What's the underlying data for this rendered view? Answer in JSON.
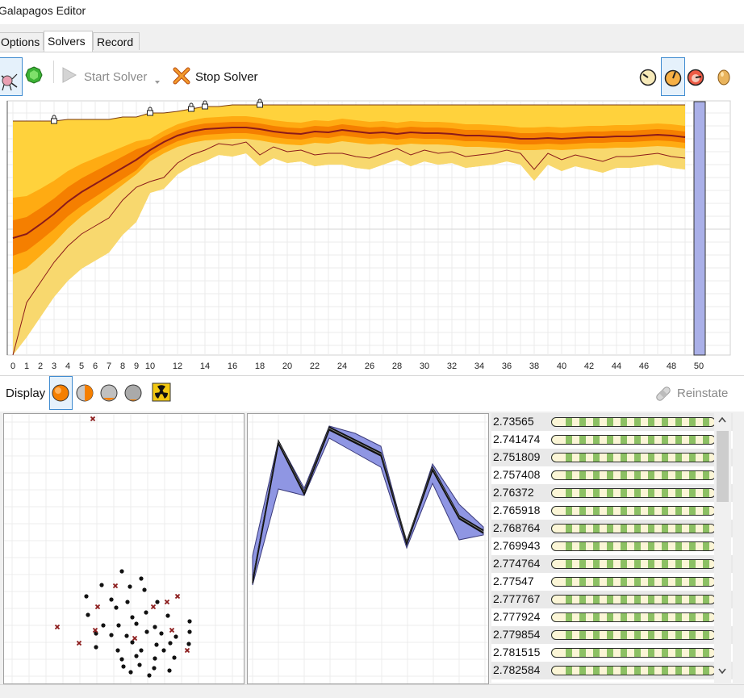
{
  "window": {
    "title": "Galapagos Editor"
  },
  "tabs": [
    {
      "label": "Options",
      "active": false
    },
    {
      "label": "Solvers",
      "active": true
    },
    {
      "label": "Record",
      "active": false
    }
  ],
  "toolbar": {
    "start_label": "Start Solver",
    "stop_label": "Stop Solver",
    "left_icons": [
      "evolutionary-solver-icon",
      "annealing-solver-icon"
    ],
    "right_icons": [
      "speed-slow-icon",
      "speed-medium-icon",
      "speed-fast-icon",
      "egg-icon"
    ]
  },
  "fitness_chart": {
    "x_ticks": [
      "0",
      "1",
      "2",
      "3",
      "4",
      "5",
      "6",
      "7",
      "8",
      "9",
      "10",
      "12",
      "14",
      "16",
      "18",
      "20",
      "22",
      "24",
      "26",
      "28",
      "30",
      "32",
      "34",
      "36",
      "38",
      "40",
      "42",
      "44",
      "46",
      "48",
      "50"
    ],
    "colors": {
      "best": "#ffd23c",
      "band_outer": "#ffab12",
      "band_inner": "#f57f00",
      "median": "#8b1a1a",
      "worst_band": "#f7d873",
      "current": "#aab0e8"
    }
  },
  "display": {
    "label": "Display",
    "reinstate_label": "Reinstate",
    "icons": [
      "display-orange-ball-icon",
      "display-half-ball-icon",
      "display-grey-ball-icon",
      "display-dark-ball-icon",
      "radiation-icon"
    ]
  },
  "genomes": {
    "values": [
      "2.73565",
      "2.741474",
      "2.751809",
      "2.757408",
      "2.76372",
      "2.765918",
      "2.768764",
      "2.769943",
      "2.774764",
      "2.77547",
      "2.777767",
      "2.777924",
      "2.779854",
      "2.781515",
      "2.782584"
    ]
  }
}
